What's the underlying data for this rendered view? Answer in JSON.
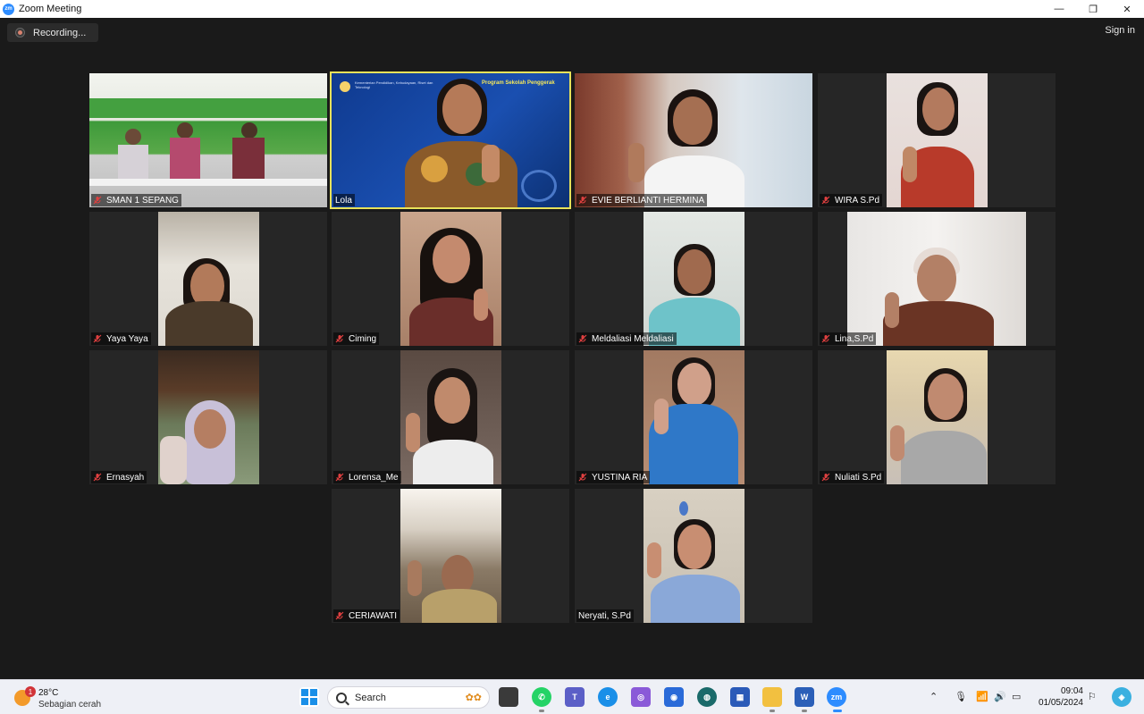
{
  "window": {
    "title": "Zoom Meeting",
    "controls": [
      "—",
      "❐",
      "✕"
    ]
  },
  "meeting": {
    "recording_label": "Recording...",
    "signin_label": "Sign in",
    "slide_brand": "Kementerian Pendidikan, Kebudayaan, Riset dan Teknologi",
    "slide_title": "Program Sekolah Penggerak",
    "participants": [
      {
        "name": "SMAN 1 SEPANG",
        "muted": true
      },
      {
        "name": "Lola",
        "muted": false,
        "active": true
      },
      {
        "name": "EVIE BERLIANTI HERMINA",
        "muted": true
      },
      {
        "name": "WIRA S.Pd",
        "muted": true
      },
      {
        "name": "Yaya Yaya",
        "muted": true
      },
      {
        "name": "Ciming",
        "muted": true
      },
      {
        "name": "Meldaliasi Meldaliasi",
        "muted": true
      },
      {
        "name": "Lina,S.Pd",
        "muted": true
      },
      {
        "name": "Ernasyah",
        "muted": true
      },
      {
        "name": "Lorensa_Me",
        "muted": true
      },
      {
        "name": "YUSTINA RIA",
        "muted": true
      },
      {
        "name": "Nuliati S.Pd",
        "muted": true
      },
      {
        "name": "CERIAWATI",
        "muted": true
      },
      {
        "name": "Neryati, S.Pd",
        "muted": false
      }
    ]
  },
  "taskbar": {
    "weather_temp": "28°C",
    "weather_desc": "Sebagian cerah",
    "weather_badge": "1",
    "search_label": "Search",
    "time": "09:04",
    "date": "01/05/2024",
    "icons": [
      "windows-start",
      "search",
      "task-view",
      "whatsapp",
      "teams",
      "edge",
      "copilot",
      "app-store",
      "browser",
      "store",
      "file-explorer",
      "word",
      "zoom"
    ],
    "colors": {
      "zoom_blue": "#2d8cff",
      "active_border": "#e8e25a",
      "muted_red": "#e04040"
    }
  }
}
